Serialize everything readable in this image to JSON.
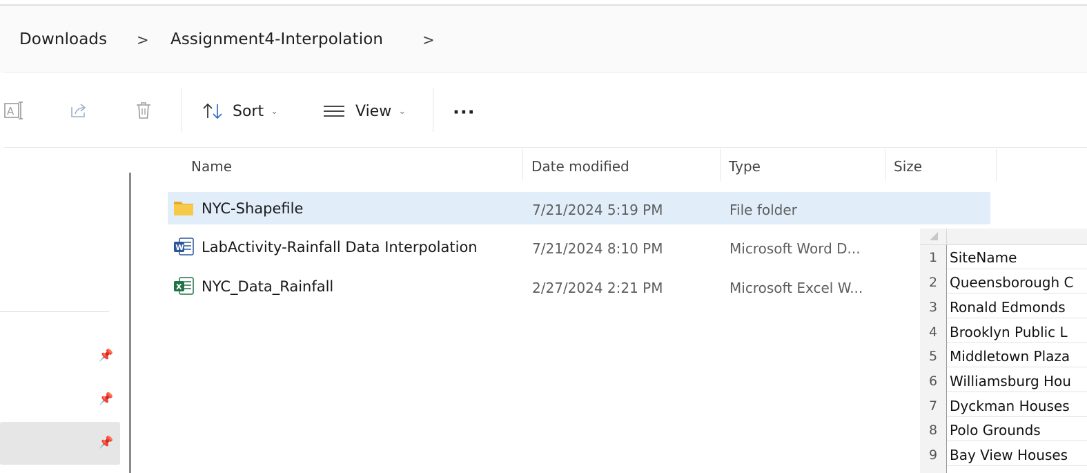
{
  "breadcrumb": {
    "items": [
      "Downloads",
      "Assignment4-Interpolation"
    ],
    "separator": ">"
  },
  "toolbar": {
    "sort_label": "Sort",
    "view_label": "View",
    "more_label": "···"
  },
  "columns": {
    "name": "Name",
    "date": "Date modified",
    "type": "Type",
    "size": "Size"
  },
  "files": [
    {
      "name": "NYC-Shapefile",
      "date": "7/21/2024 5:19 PM",
      "type": "File folder",
      "icon": "folder-icon"
    },
    {
      "name": "LabActivity-Rainfall Data Interpolation",
      "date": "7/21/2024 8:10 PM",
      "type": "Microsoft Word D...",
      "icon": "word-doc-icon"
    },
    {
      "name": "NYC_Data_Rainfall",
      "date": "2/27/2024 2:21 PM",
      "type": "Microsoft Excel W...",
      "icon": "excel-doc-icon"
    }
  ],
  "spreadsheet": {
    "row_numbers": [
      "1",
      "2",
      "3",
      "4",
      "5",
      "6",
      "7",
      "8",
      "9"
    ],
    "cells": [
      "SiteName",
      "Queensborough C",
      "Ronald Edmonds",
      "Brooklyn Public L",
      "Middletown Plaza",
      "Williamsburg Hou",
      "Dyckman Houses",
      "Polo Grounds",
      "Bay View Houses"
    ]
  },
  "colors": {
    "selection": "#e1edf9",
    "folder": "#f7c948",
    "word": "#2b579a",
    "excel": "#217346"
  }
}
